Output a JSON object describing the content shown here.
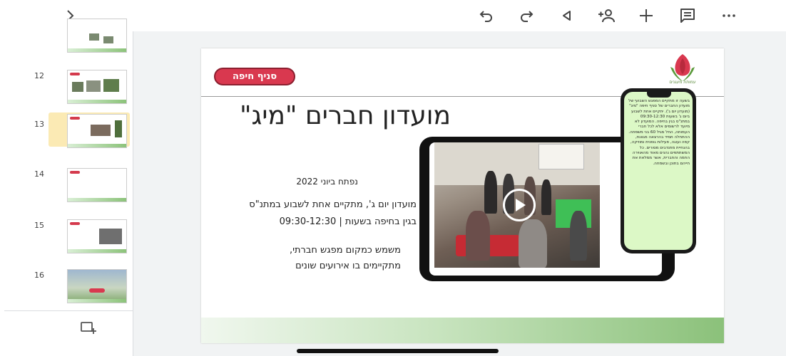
{
  "toolbar": {
    "expand_icon": "chevron-right-icon",
    "actions": [
      "undo-icon",
      "redo-icon",
      "play-slideshow-icon",
      "add-person-icon",
      "add-icon",
      "comment-icon",
      "more-icon"
    ]
  },
  "slides": [
    {
      "number": ""
    },
    {
      "number": "12"
    },
    {
      "number": "13",
      "active": true
    },
    {
      "number": "14"
    },
    {
      "number": "15"
    },
    {
      "number": "16"
    }
  ],
  "slide": {
    "branch": "סניף חיפה",
    "title": "מועדון חברים \"מיג\"",
    "opened": "נפתח ביוני 2022",
    "line1": "מועדון יום ג', מתקיים אחת לשבוע במתנ\"ס",
    "line2": "בגין בחיפה בשעות | 09:30-12:30",
    "line3": "משמש כמקום מפגש חברתי,",
    "line4": "מתקיימים בו אירועים שונים",
    "logo_text": "עמותת מעגנים",
    "phone_text": "בשעה זו מתקיים המפגש השבועי של מועדון החברים של סניף חיפה \"מיג\" (מועדון יום ג'). יתקיים אחת לשבוע ביום ג' בשעות 09:30-12:30 במתנ\"ס בגין בחיפה. המועדון לא מיועד לרשומים אלא לכל חברי העמותה, החל מגיל 60 בני משפחה. ההתחלה תמיד בהרצאה מגוונת, קפה ועוגה, פעילות גופנית ומוזיקה, בהנחיית מתנדבים מסורים. כל המשתתפים נהנים מאוד מהאווירה החמה והחברית, אשר ממלאת את חייהם בתוכן ובשמחה."
  },
  "colors": {
    "accent_red": "#d9384f",
    "green_strip": "#8bc17a",
    "active_slide": "#fbeab4"
  }
}
